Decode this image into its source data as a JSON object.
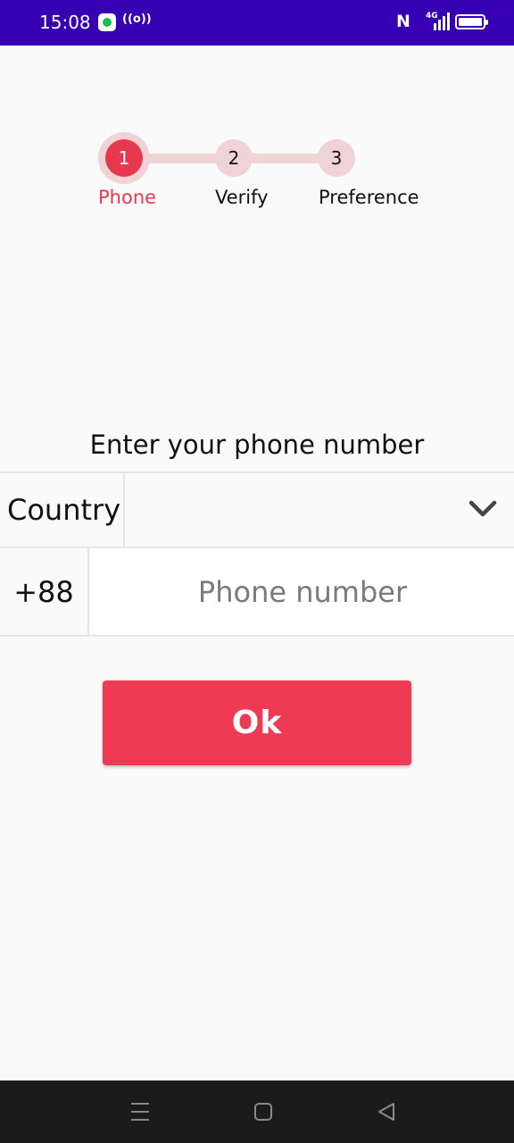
{
  "status_bar": {
    "time": "15:08",
    "radio_icon": "((o))",
    "nfc_icon": "N",
    "network_type": "4G",
    "icons": [
      "message-app-icon",
      "hotspot-icon",
      "nfc-icon",
      "signal-icon",
      "battery-icon"
    ]
  },
  "stepper": {
    "steps": [
      {
        "number": "1",
        "label": "Phone",
        "state": "active"
      },
      {
        "number": "2",
        "label": "Verify",
        "state": "inactive"
      },
      {
        "number": "3",
        "label": "Preference",
        "state": "inactive"
      }
    ]
  },
  "form": {
    "heading": "Enter your phone number",
    "country_label": "Country",
    "country_value": "",
    "dial_code": "+88",
    "phone_value": "",
    "phone_placeholder": "Phone number",
    "ok_label": "Ok"
  },
  "colors": {
    "status_bar": "#3700b3",
    "accent": "#ee3a53",
    "step_inactive": "#efd3d5",
    "background": "#fafafa",
    "nav_bar": "#1b1b1b"
  },
  "nav_bar": {
    "icons": [
      "menu-icon",
      "home-icon",
      "back-icon"
    ]
  }
}
